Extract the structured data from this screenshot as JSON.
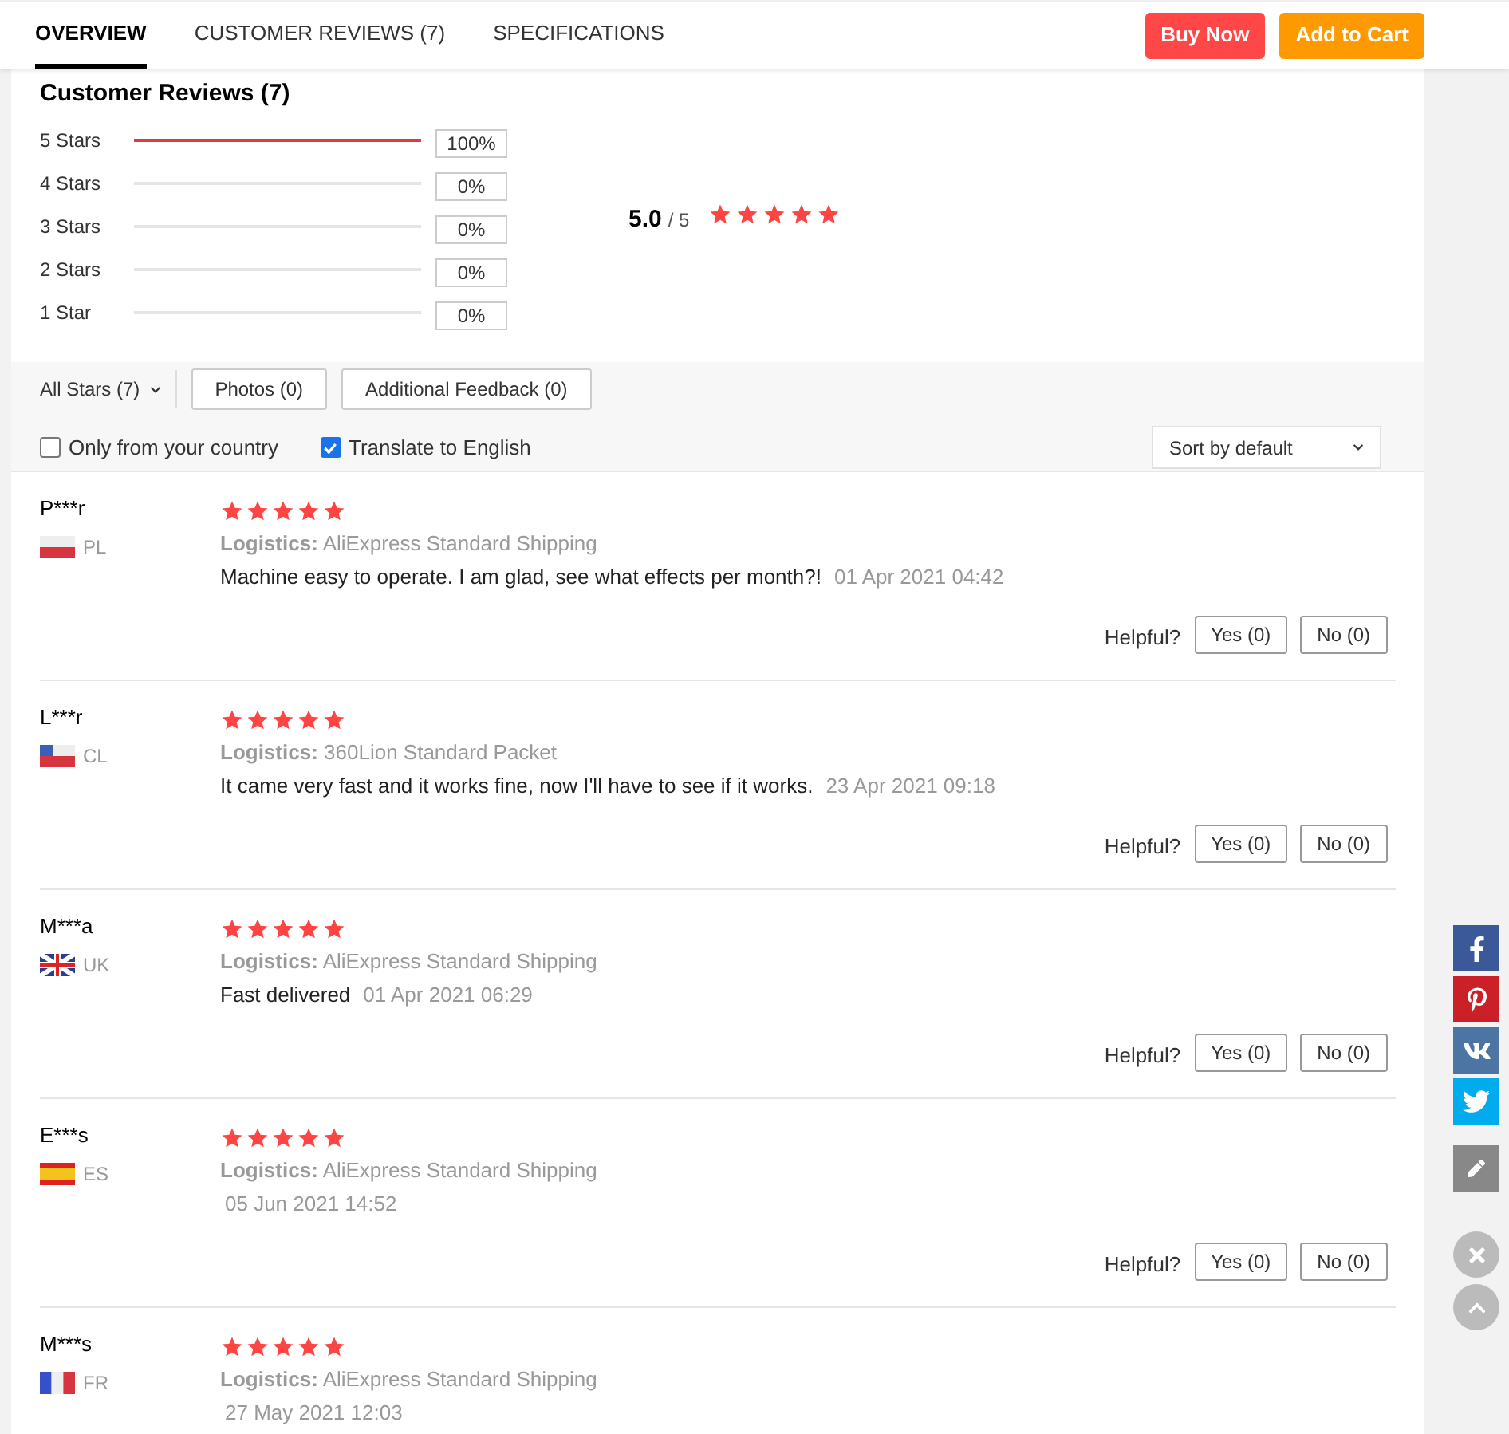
{
  "tabs": [
    {
      "label": "OVERVIEW",
      "selected": true
    },
    {
      "label": "CUSTOMER REVIEWS (7)",
      "selected": false
    },
    {
      "label": "SPECIFICATIONS",
      "selected": false
    }
  ],
  "actions": {
    "buy_now": "Buy Now",
    "add_to_cart": "Add to Cart"
  },
  "summary": {
    "title": "Customer Reviews (7)",
    "average": "5.0",
    "out_of": "/ 5",
    "stars": 5,
    "histogram": [
      {
        "label": "5 Stars",
        "level": 1,
        "percent": "100%"
      },
      {
        "label": "4 Stars",
        "level": 0,
        "percent": "0%"
      },
      {
        "label": "3 Stars",
        "level": 0,
        "percent": "0%"
      },
      {
        "label": "2 Stars",
        "level": 0,
        "percent": "0%"
      },
      {
        "label": "1 Star",
        "level": 0,
        "percent": "0%"
      }
    ]
  },
  "filters": {
    "all_stars": "All Stars (7)",
    "photos": "Photos (0)",
    "additional_feedback": "Additional Feedback (0)",
    "only_country": {
      "label": "Only from your country",
      "checked": false
    },
    "translate": {
      "label": "Translate to English",
      "checked": true
    },
    "sort": "Sort by default"
  },
  "reviews": [
    {
      "name": "P***r",
      "kind": "pl",
      "country": "PL",
      "stars": 5,
      "logistics_label": "Logistics:",
      "logistics": "AliExpress Standard Shipping",
      "text": "Machine easy to operate. I am glad, see what effects per month?!",
      "date": "01 Apr 2021 04:42",
      "helpful": "Helpful?",
      "yes": "Yes (0)",
      "no": "No (0)"
    },
    {
      "name": "L***r",
      "kind": "cl",
      "country": "CL",
      "stars": 5,
      "logistics_label": "Logistics:",
      "logistics": "360Lion Standard Packet",
      "text": "It came very fast and it works fine, now I'll have to see if it works.",
      "date": "23 Apr 2021 09:18",
      "helpful": "Helpful?",
      "yes": "Yes (0)",
      "no": "No (0)"
    },
    {
      "name": "M***a",
      "kind": "uk",
      "country": "UK",
      "stars": 5,
      "logistics_label": "Logistics:",
      "logistics": "AliExpress Standard Shipping",
      "text": "Fast delivered",
      "date": "01 Apr 2021 06:29",
      "helpful": "Helpful?",
      "yes": "Yes (0)",
      "no": "No (0)"
    },
    {
      "name": "E***s",
      "kind": "es",
      "country": "ES",
      "stars": 5,
      "logistics_label": "Logistics:",
      "logistics": "AliExpress Standard Shipping",
      "date": "05 Jun 2021 14:52",
      "helpful": "Helpful?",
      "yes": "Yes (0)",
      "no": "No (0)"
    },
    {
      "name": "M***s",
      "kind": "fr",
      "country": "FR",
      "stars": 5,
      "logistics_label": "Logistics:",
      "logistics": "AliExpress Standard Shipping",
      "date": "27 May 2021 12:03"
    }
  ]
}
